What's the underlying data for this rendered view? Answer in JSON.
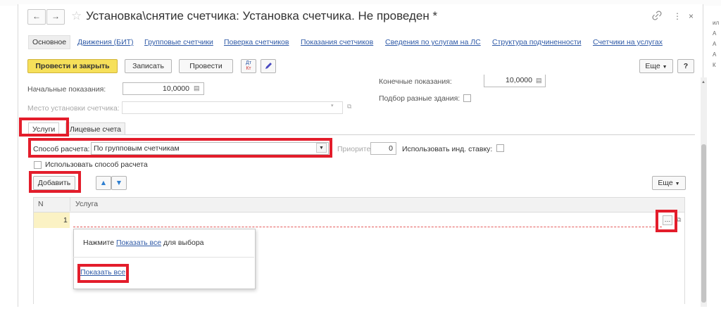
{
  "window": {
    "title": "Установка\\снятие счетчика: Установка счетчика. Не проведен *",
    "link_icon": "link-icon",
    "more_icon": "⋮",
    "close_icon": "×"
  },
  "nav": {
    "back": "←",
    "forward": "→",
    "star": "☆"
  },
  "tabs": [
    {
      "label": "Основное",
      "active": true
    },
    {
      "label": "Движения (БИТ)"
    },
    {
      "label": "Групповые счетчики"
    },
    {
      "label": "Поверка счетчиков"
    },
    {
      "label": "Показания счетчиков"
    },
    {
      "label": "Сведения по услугам на ЛС"
    },
    {
      "label": "Структура подчиненности"
    },
    {
      "label": "Счетчики на услугах"
    }
  ],
  "toolbar": {
    "post_close": "Провести и закрыть",
    "save": "Записать",
    "post": "Провести",
    "dtkt_top": "Дт",
    "dtkt_bottom": "Кт",
    "more": "Еще",
    "help": "?"
  },
  "form": {
    "initial_label": "Начальные показания:",
    "initial_value": "10,0000",
    "final_label": "Конечные показания:",
    "final_value": "10,0000",
    "place_label": "Место установки счетчика:",
    "buildings_label": "Подбор разные здания:"
  },
  "subtabs": {
    "services": "Услуги",
    "accounts": "Лицевые счета"
  },
  "services": {
    "calc_label": "Способ расчета:",
    "calc_value": "По групповым счетчикам",
    "priority_label": "Приоритет:",
    "priority_value": "0",
    "ind_rate_label": "Использовать инд. ставку:",
    "use_method_label": "Использовать способ расчета",
    "add_button": "Добавить",
    "more": "Еще",
    "columns": {
      "n": "N",
      "service": "Услуга"
    },
    "rows": [
      {
        "n": "1",
        "service": ""
      }
    ]
  },
  "popup": {
    "prefix": "Нажмите ",
    "link": "Показать все",
    "suffix": " для выбора",
    "link_bottom": "Показать все"
  },
  "side_text": [
    "ил",
    "А",
    "А",
    "А",
    "К",
    "К"
  ],
  "colors": {
    "accent_yellow": "#f6e05a",
    "highlight_red": "#e31d2b",
    "link_blue": "#2f5aa7"
  }
}
